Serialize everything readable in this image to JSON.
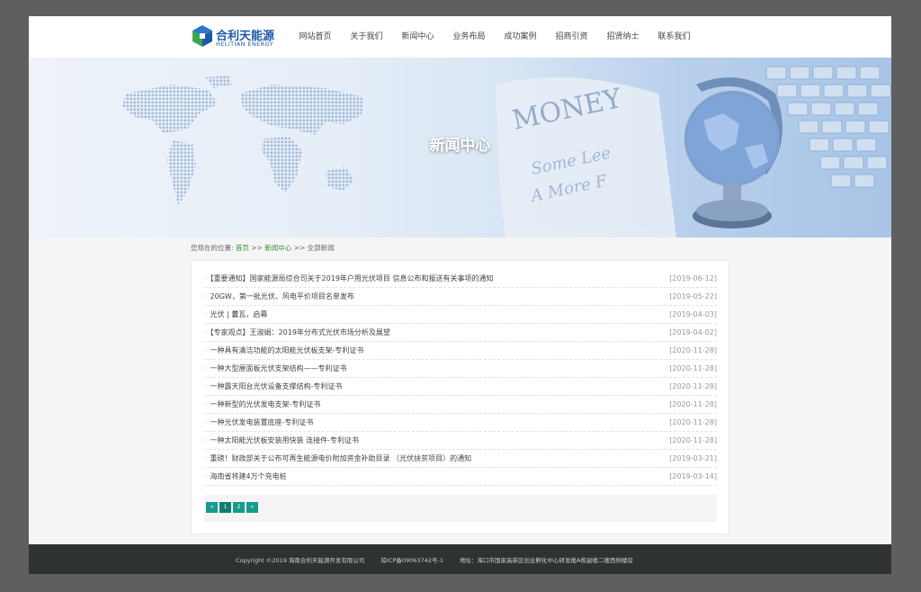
{
  "header": {
    "logo_cn": "合利天能源",
    "logo_en": "HELITIAN ENERGY",
    "nav": [
      "网站首页",
      "关于我们",
      "新闻中心",
      "业务布局",
      "成功案例",
      "招商引资",
      "招贤纳士",
      "联系我们"
    ]
  },
  "banner": {
    "title": "新闻中心"
  },
  "breadcrumb": {
    "prefix": "您现在的位置:",
    "home": "首页",
    "sep1": ">>",
    "section": "新闻中心",
    "sep2": ">>",
    "current": "全部新闻"
  },
  "news": [
    {
      "title": "【重要通知】国家能源局综合司关于2019年户用光伏项目 信息公布和报送有关事项的通知",
      "date": "[2019-06-12]"
    },
    {
      "title": "20GW，第一批光伏、风电平价项目名单发布",
      "date": "[2019-05-22]"
    },
    {
      "title": "光伏 | 曩瓦，启幕",
      "date": "[2019-04-03]"
    },
    {
      "title": "【专家观点】王淑娟：2019年分布式光伏市场分析及展望",
      "date": "[2019-04-02]"
    },
    {
      "title": "一种具有清洁功能的太阳能光伏板支架-专利证书",
      "date": "[2020-11-28]"
    },
    {
      "title": "一种大型屋面板光伏支架结构——专利证书",
      "date": "[2020-11-28]"
    },
    {
      "title": "一种露天阳台光伏设备支撑结构-专利证书",
      "date": "[2020-11-28]"
    },
    {
      "title": "一种新型的光伏发电支架-专利证书",
      "date": "[2020-11-28]"
    },
    {
      "title": "一种光伏发电装置底座-专利证书",
      "date": "[2020-11-28]"
    },
    {
      "title": "一种太阳能光伏板安装用快装 连接件-专利证书",
      "date": "[2020-11-28]"
    },
    {
      "title": "重磅！财政部关于公布可再生能源电价附加资金补助目录 （光伏扶贫项目）的通知",
      "date": "[2019-03-21]"
    },
    {
      "title": "海南省将建4万个充电桩",
      "date": "[2019-03-14]"
    }
  ],
  "pager": {
    "prev": "«",
    "p1": "1",
    "p2": "2",
    "next": "»"
  },
  "footer": {
    "copyright": "Copyright ©2019 海南合利天能源开发有限公司",
    "icp": "琼ICP备09063742号-1",
    "address": "地址：海口市国家高新区创业孵化中心研发楼A栋副楼二楼西侧楼房"
  },
  "colors": {
    "accent": "#169b8e",
    "brand": "#1c5aa8",
    "footer_bg": "#2e3233"
  }
}
